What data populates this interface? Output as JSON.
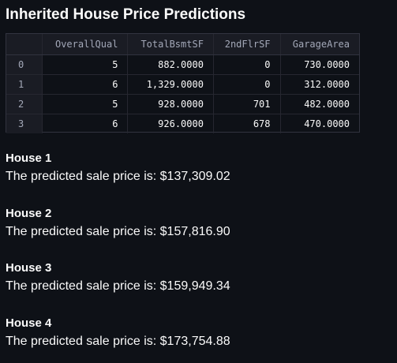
{
  "page": {
    "title": "Inherited House Price Predictions"
  },
  "table": {
    "columns": [
      "",
      "OverallQual",
      "TotalBsmtSF",
      "2ndFlrSF",
      "GarageArea"
    ],
    "rows": [
      {
        "index": "0",
        "cells": [
          "5",
          "882.0000",
          "0",
          "730.0000"
        ]
      },
      {
        "index": "1",
        "cells": [
          "6",
          "1,329.0000",
          "0",
          "312.0000"
        ]
      },
      {
        "index": "2",
        "cells": [
          "5",
          "928.0000",
          "701",
          "482.0000"
        ]
      },
      {
        "index": "3",
        "cells": [
          "6",
          "926.0000",
          "678",
          "470.0000"
        ]
      }
    ]
  },
  "predictions": [
    {
      "title": "House 1",
      "text": "The predicted sale price is: $137,309.02"
    },
    {
      "title": "House 2",
      "text": "The predicted sale price is: $157,816.90"
    },
    {
      "title": "House 3",
      "text": "The predicted sale price is: $159,949.34"
    },
    {
      "title": "House 4",
      "text": "The predicted sale price is: $173,754.88"
    }
  ]
}
